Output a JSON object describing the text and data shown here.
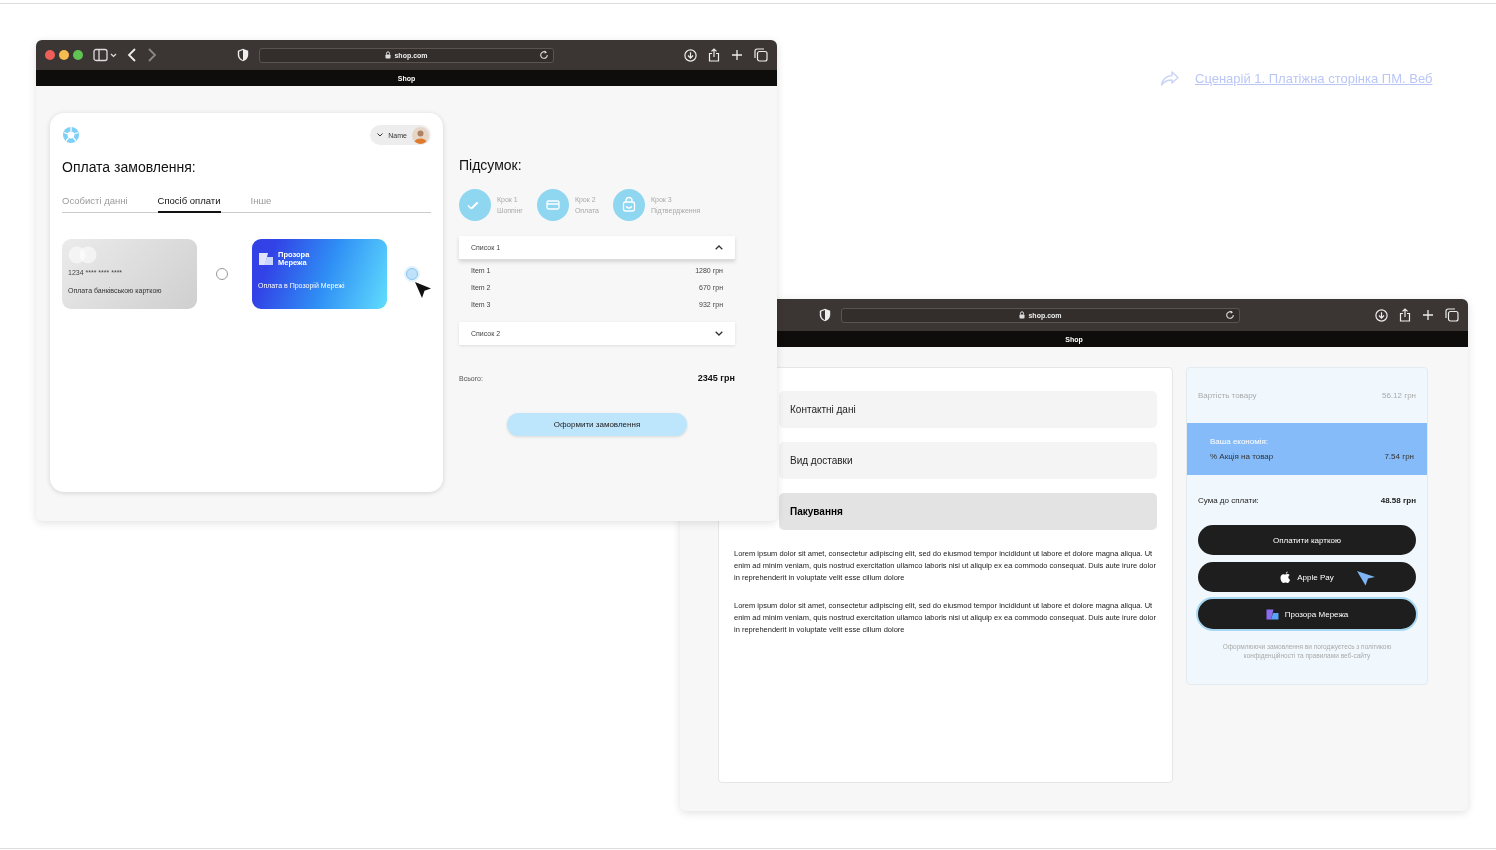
{
  "scenario_link": {
    "text": "Сценарій 1. Платіжна сторінка ПМ. Веб"
  },
  "checkout_window": {
    "url": "shop.com",
    "page_title": "Shop",
    "card": {
      "user_name": "Name",
      "heading": "Оплата замовлення:",
      "tabs": [
        {
          "label": "Особисті данні",
          "selected": false
        },
        {
          "label": "Спосіб оплати",
          "selected": true
        },
        {
          "label": "Інше",
          "selected": false
        }
      ],
      "payment_options": [
        {
          "kind": "bank_card",
          "number": "1234 **** **** ****",
          "caption": "Оплата банківською карткою",
          "selected": false
        },
        {
          "kind": "network",
          "logo_text": "Прозора Мережа",
          "caption": "Оплата в Прозорій Мережі",
          "selected": true
        }
      ]
    },
    "summary": {
      "heading": "Підсумок:",
      "steps": [
        {
          "kind": "check",
          "label": "Крок 1",
          "name": "Шоппінг"
        },
        {
          "kind": "card",
          "label": "Крок 2",
          "name": "Оплата"
        },
        {
          "kind": "bag",
          "label": "Крок 3",
          "name": "Підтвердження"
        }
      ],
      "lists": [
        {
          "title": "Список 1",
          "expanded": true,
          "items": [
            {
              "name": "Item 1",
              "price": "1280 грн"
            },
            {
              "name": "Item 2",
              "price": "670 грн"
            },
            {
              "name": "Item 3",
              "price": "932 грн"
            }
          ]
        },
        {
          "title": "Список 2",
          "expanded": false
        }
      ],
      "total_label": "Всього:",
      "total": "2345 грн",
      "button": "Оформити замовлення"
    }
  },
  "order_window": {
    "url": "shop.com",
    "page_title": "Shop",
    "sections": [
      {
        "label": "Контактні дані",
        "selected": false
      },
      {
        "label": "Вид доставки",
        "selected": false
      },
      {
        "label": "Пакування",
        "selected": true
      }
    ],
    "paragraphs": [
      "Lorem ipsum dolor sit amet, consectetur adipiscing elit, sed do eiusmod tempor incididunt ut labore et dolore magna aliqua. Ut enim ad minim veniam, quis nostrud exercitation ullamco laboris nisi ut aliquip ex ea commodo consequat. Duis aute irure dolor in reprehenderit in voluptate velit esse cillum dolore",
      "Lorem ipsum dolor sit amet, consectetur adipiscing elit, sed do eiusmod tempor incididunt ut labore et dolore magna aliqua. Ut enim ad minim veniam, quis nostrud exercitation ullamco laboris nisi ut aliquip ex ea commodo consequat. Duis aute irure dolor in reprehenderit in voluptate velit esse cillum dolore"
    ],
    "cost_label": "Вартість товару",
    "cost": "56.12 грн",
    "savings_title": "Ваша економія:",
    "discount_label": "% Акція на товар",
    "discount": "7.54 грн",
    "due_label": "Сума до сплати:",
    "due": "48.58 грн",
    "buttons": [
      {
        "kind": "card",
        "label": "Оплатити карткою",
        "focused": false
      },
      {
        "kind": "apple",
        "label": "Apple Pay",
        "focused": false
      },
      {
        "kind": "network",
        "label": "Прозора Мережа",
        "focused": true
      }
    ],
    "note": "Оформлюючи замовлення ви погоджуєтесь з політикою конфіденційності та правилами веб-сайту"
  }
}
